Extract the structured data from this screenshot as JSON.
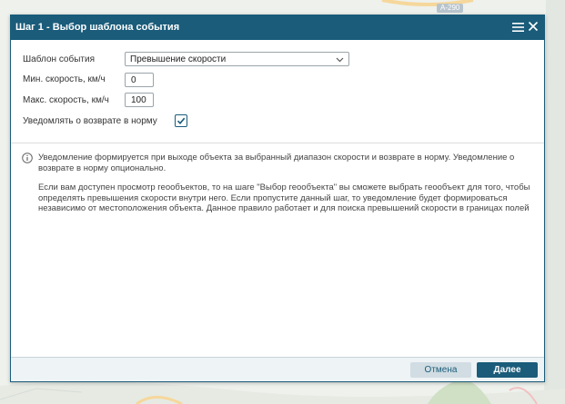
{
  "map": {
    "road_badge": "А-290"
  },
  "dialog": {
    "title": "Шаг 1 - Выбор шаблона события",
    "menu_icon": "hamburger-icon",
    "close_icon": "close-icon"
  },
  "form": {
    "template_label": "Шаблон события",
    "template_value": "Превышение скорости",
    "min_speed_label": "Мин. скорость, км/ч",
    "min_speed_value": "0",
    "max_speed_label": "Макс. скорость, км/ч",
    "max_speed_value": "100",
    "notify_return_label": "Уведомлять о возврате в норму",
    "notify_return_checked": true
  },
  "info": {
    "icon": "info-icon",
    "paragraph1": "Уведомление формируется при выходе объекта за выбранный диапазон скорости и возврате в норму. Уведомление о возврате в норму опционально.",
    "paragraph2": "Если вам доступен просмотр геообъектов, то на шаге \"Выбор геообъекта\" вы сможете выбрать геообъект для того, чтобы определять превышения скорости внутри него. Если пропустите данный шаг, то уведомление будет формироваться независимо от местоположения объекта. Данное правило работает и для поиска превышений скорости в границах полей"
  },
  "footer": {
    "cancel_label": "Отмена",
    "next_label": "Далее"
  },
  "colors": {
    "header_bg": "#1a5c7a",
    "button_primary": "#1a5c7a",
    "button_secondary": "#d1dde3"
  }
}
